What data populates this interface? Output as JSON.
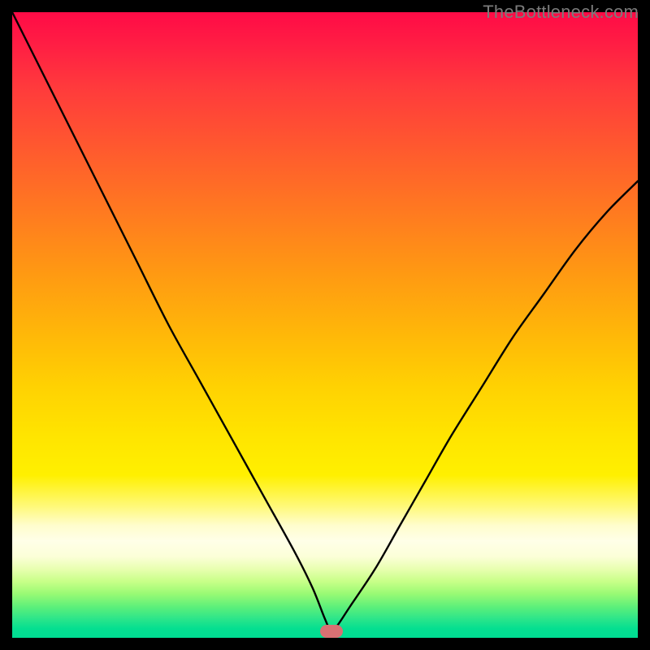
{
  "watermark": "TheBottleneck.com",
  "colors": {
    "frame": "#000000",
    "curve": "#000000",
    "marker": "#d87073",
    "gradient_top": "#ff0b46",
    "gradient_bottom": "#00dc92"
  },
  "chart_data": {
    "type": "line",
    "title": "",
    "xlabel": "",
    "ylabel": "",
    "xlim": [
      0,
      100
    ],
    "ylim": [
      0,
      100
    ],
    "notes": "V-shaped bottleneck curve on red→yellow→green vertical gradient. Y≈0 is at the bottom green band (optimal / no bottleneck); Y increases toward top red (severe). Curve bottoms out near x≈51 with a small salmon marker at the minimum.",
    "series": [
      {
        "name": "bottleneck-curve",
        "x": [
          0,
          5,
          10,
          15,
          20,
          25,
          30,
          35,
          40,
          45,
          48,
          50,
          51,
          52,
          54,
          58,
          62,
          66,
          70,
          75,
          80,
          85,
          90,
          95,
          100
        ],
        "values": [
          100,
          90,
          80,
          70,
          60,
          50,
          41,
          32,
          23,
          14,
          8,
          3,
          1,
          2,
          5,
          11,
          18,
          25,
          32,
          40,
          48,
          55,
          62,
          68,
          73
        ]
      }
    ],
    "marker": {
      "x": 51,
      "y": 1
    }
  }
}
